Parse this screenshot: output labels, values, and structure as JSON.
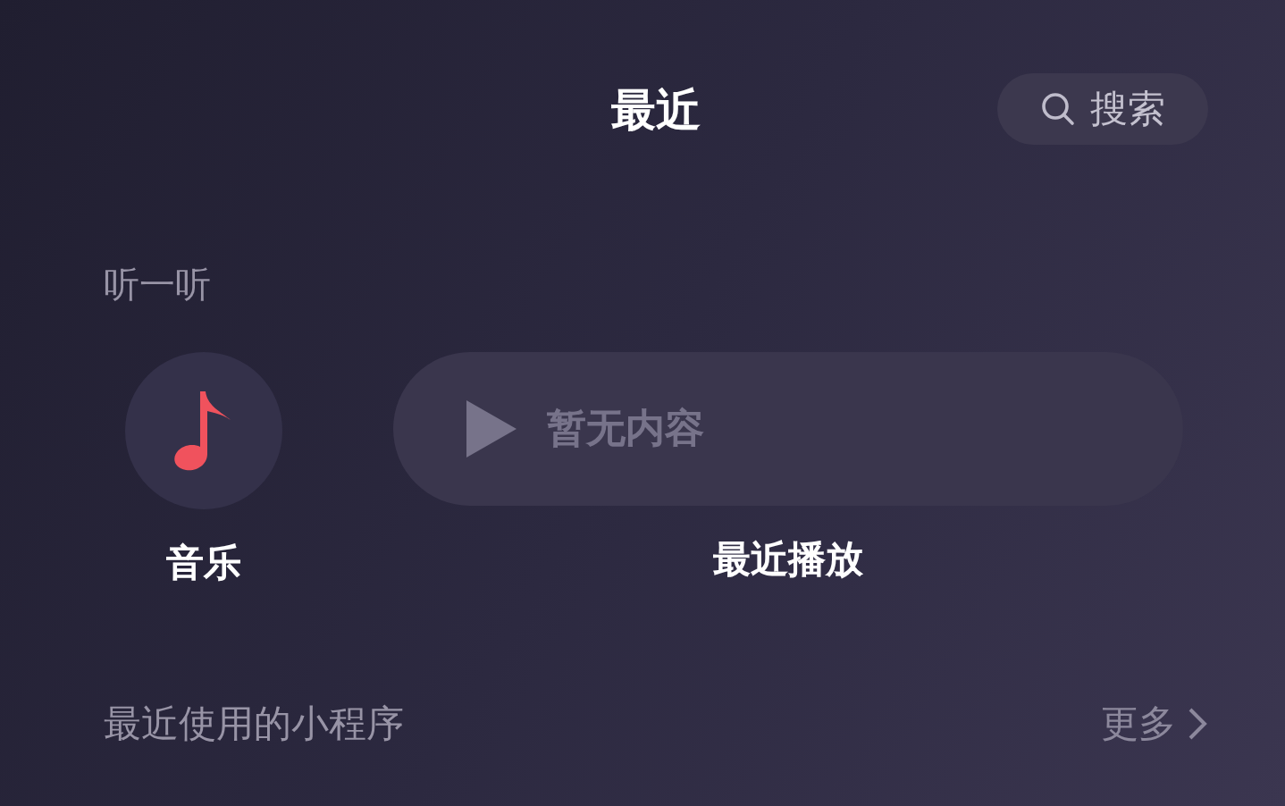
{
  "title": "最近",
  "search": {
    "label": "搜索"
  },
  "listen": {
    "heading": "听一听",
    "items": [
      {
        "kind": "music",
        "label": "音乐"
      },
      {
        "kind": "recent",
        "label": "最近播放",
        "empty_text": "暂无内容"
      }
    ]
  },
  "mini_programs": {
    "heading": "最近使用的小程序",
    "more": "更多"
  }
}
